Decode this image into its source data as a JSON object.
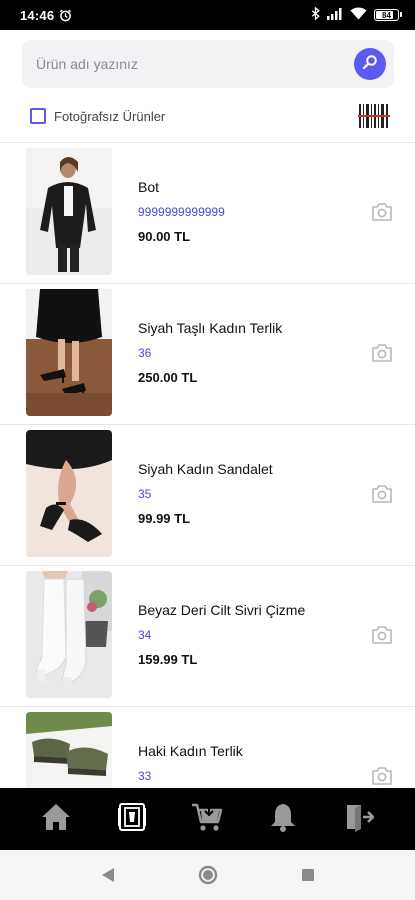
{
  "status_bar": {
    "time": "14:46",
    "battery": "84",
    "battery_level": 0.84,
    "icons": [
      "alarm-icon",
      "bluetooth-icon",
      "signal-icon",
      "wifi-icon",
      "battery-icon"
    ]
  },
  "search": {
    "placeholder": "Ürün adı yazınız",
    "value": "",
    "button_icon": "search-icon"
  },
  "filter": {
    "checkbox_label": "Fotoğrafsız Ürünler",
    "checked": false,
    "scan_icon": "barcode-icon"
  },
  "products": [
    {
      "name": "Bot",
      "code": "9999999999999",
      "price": "90.00 TL",
      "image": "woman-black-blazer-photo",
      "action_icon": "camera-icon"
    },
    {
      "name": "Siyah Taşlı Kadın Terlik",
      "code": "36",
      "price": "250.00 TL",
      "image": "black-heeled-sandals-photo",
      "action_icon": "camera-icon"
    },
    {
      "name": "Siyah Kadın Sandalet",
      "code": "35",
      "price": "99.99 TL",
      "image": "black-ankle-strap-sandals-photo",
      "action_icon": "camera-icon"
    },
    {
      "name": "Beyaz Deri Cilt Sivri Çizme",
      "code": "34",
      "price": "159.99 TL",
      "image": "white-leather-boots-photo",
      "action_icon": "camera-icon"
    },
    {
      "name": "Haki Kadın Terlik",
      "code": "33",
      "price": "",
      "image": "khaki-slippers-photo",
      "action_icon": "camera-icon"
    }
  ],
  "bottom_nav": [
    "home-icon",
    "product-catalog-icon",
    "cart-icon",
    "bell-icon",
    "logout-icon"
  ],
  "system_nav": [
    "back-icon",
    "home-circle-icon",
    "recents-icon"
  ],
  "colors": {
    "accent": "#5b5bf2",
    "code_text": "#4848d6",
    "nav_bg": "#000000",
    "search_bg": "#f2f2f4"
  }
}
